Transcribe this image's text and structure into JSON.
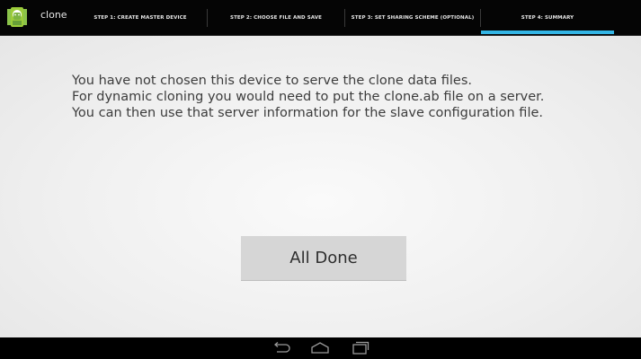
{
  "app": {
    "title": "clone"
  },
  "tabs": [
    {
      "label": "STEP 1: CREATE MASTER DEVICE",
      "selected": false
    },
    {
      "label": "STEP 2: CHOOSE FILE AND SAVE",
      "selected": false
    },
    {
      "label": "STEP 3: SET SHARING SCHEME (OPTIONAL)",
      "selected": false
    },
    {
      "label": "STEP 4: SUMMARY",
      "selected": true
    }
  ],
  "message": {
    "lines": [
      "You have not chosen this device to serve the clone data files.",
      "For dynamic cloning you would need to put the clone.ab file on a server.",
      "You can then use that server information for the slave configuration file."
    ]
  },
  "button": {
    "label": "All Done"
  },
  "nav": {
    "icons": [
      "back-icon",
      "home-icon",
      "recent-apps-icon"
    ]
  },
  "colors": {
    "accent": "#33b5e5",
    "action_bar": "#050505",
    "button": "#d6d6d6"
  }
}
